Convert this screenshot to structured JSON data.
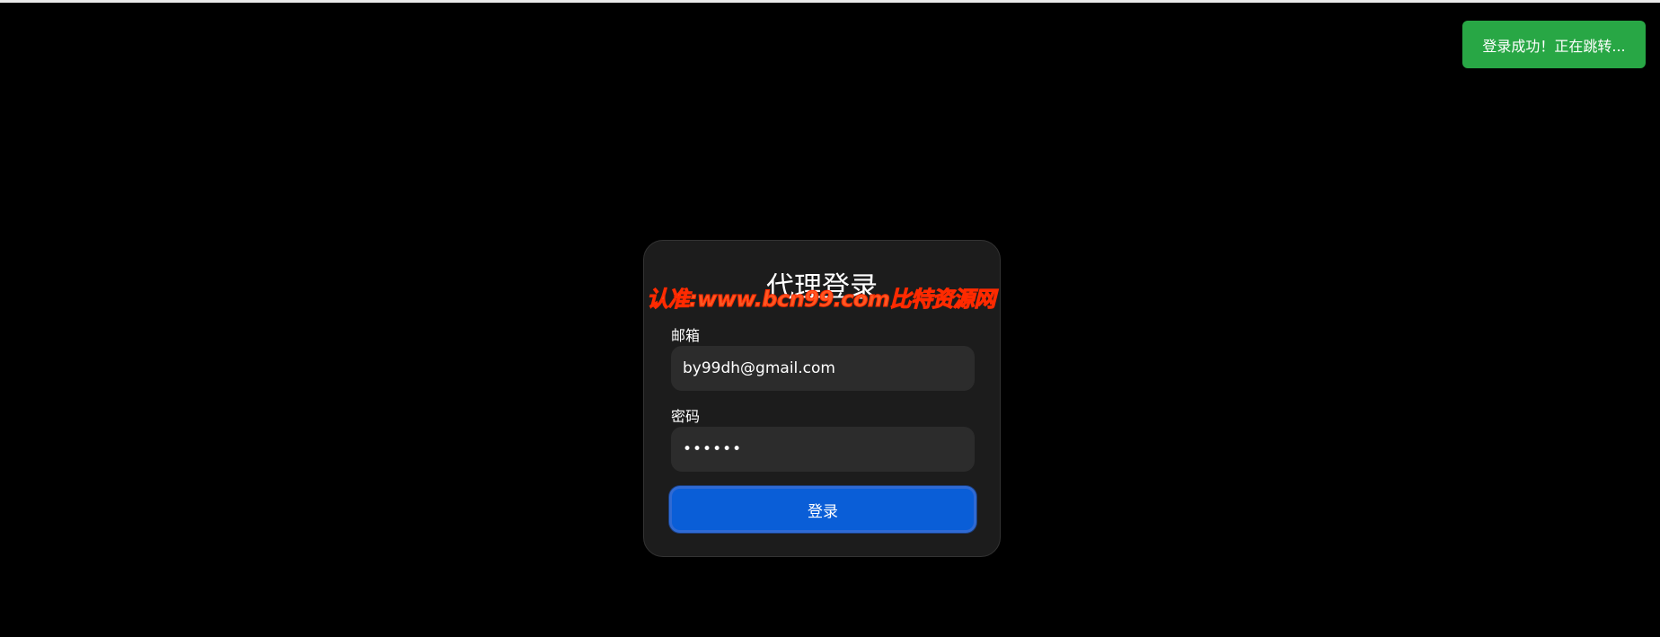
{
  "toast": {
    "message": "登录成功！正在跳转...",
    "color": "#28a745"
  },
  "watermark": {
    "text": "认准:www.bcn99.com比特资源网",
    "color": "#ff5722"
  },
  "login_card": {
    "title": "代理登录",
    "email": {
      "label": "邮箱",
      "value": "by99dh@gmail.com"
    },
    "password": {
      "label": "密码",
      "value": "••••••"
    },
    "submit_label": "登录",
    "accent_color": "#0a5ed7"
  }
}
